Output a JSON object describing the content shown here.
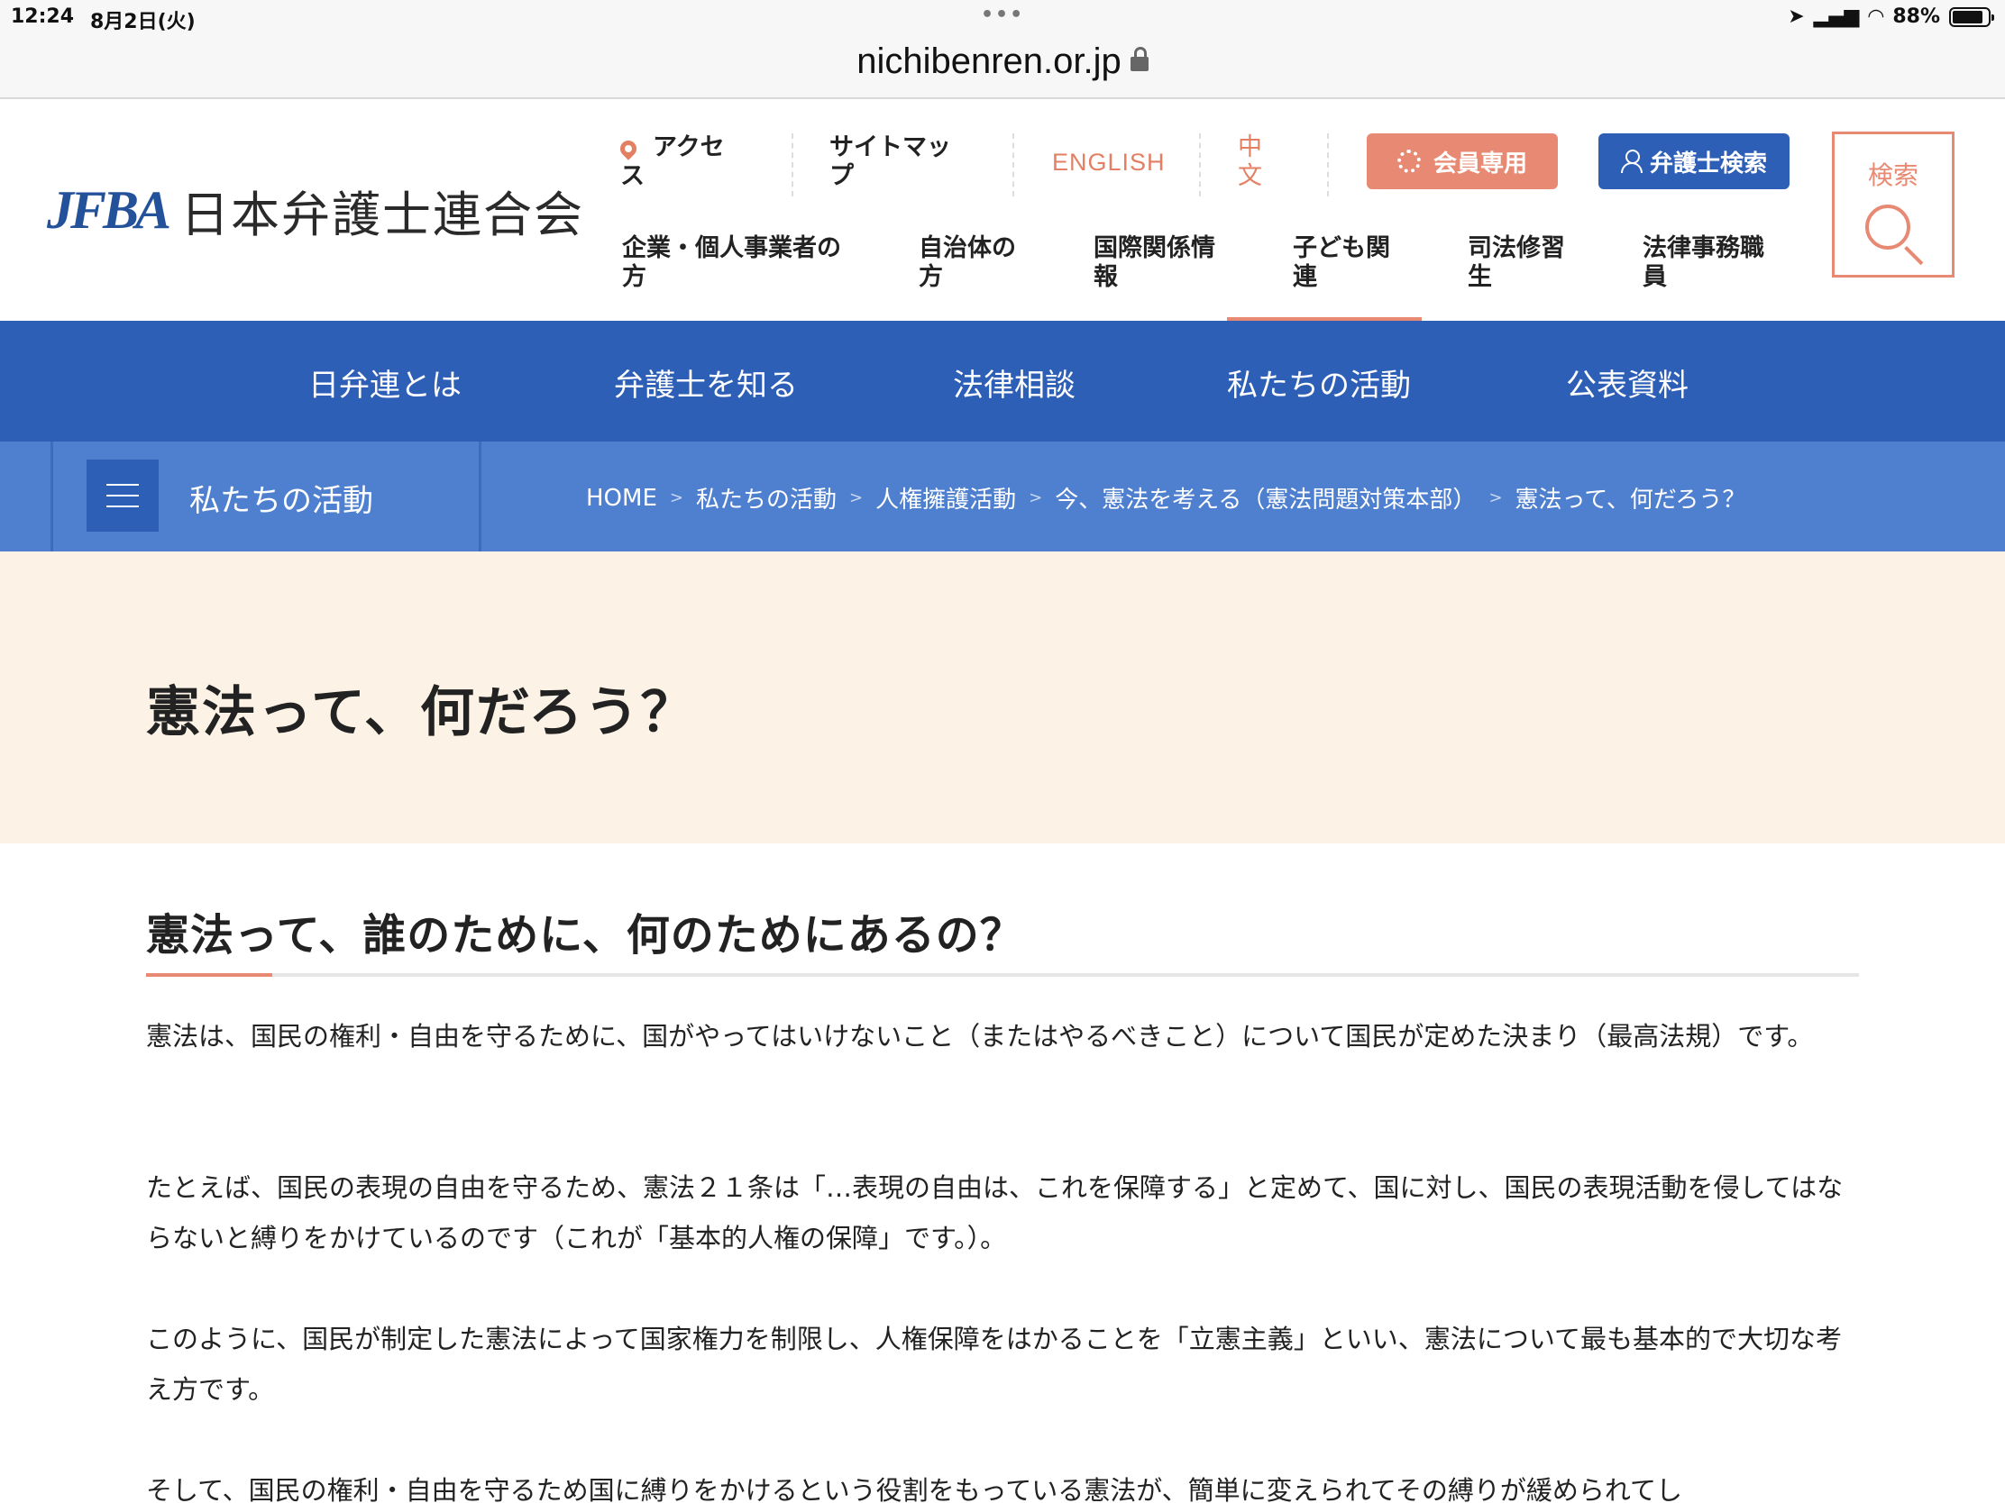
{
  "status": {
    "time": "12:24",
    "date": "8月2日(火)",
    "battery": "88%"
  },
  "browser": {
    "url": "nichibenren.or.jp"
  },
  "header": {
    "logo_mark": "JFBA",
    "logo_name": "日本弁護士連合会",
    "access": "アクセス",
    "sitemap": "サイトマップ",
    "english": "ENGLISH",
    "chinese": "中文",
    "member_button": "会員専用",
    "lawyer_search_button": "弁護士検索",
    "search": "検索",
    "categories": [
      "企業・個人事業者の方",
      "自治体の方",
      "国際関係情報",
      "子ども関連",
      "司法修習生",
      "法律事務職員"
    ]
  },
  "mainnav": [
    "日弁連とは",
    "弁護士を知る",
    "法律相談",
    "私たちの活動",
    "公表資料"
  ],
  "section": {
    "title": "私たちの活動"
  },
  "breadcrumb": [
    "HOME",
    "私たちの活動",
    "人権擁護活動",
    "今、憲法を考える（憲法問題対策本部）",
    "憲法って、何だろう？"
  ],
  "page": {
    "title": "憲法って、何だろう？",
    "heading": "憲法って、誰のために、何のためにあるの？",
    "paragraphs": [
      "憲法は、国民の権利・自由を守るために、国がやってはいけないこと（またはやるべきこと）について国民が定めた決まり（最高法規）です。",
      "たとえば、国民の表現の自由を守るため、憲法２１条は「…表現の自由は、これを保障する」と定めて、国に対し、国民の表現活動を侵してはならないと縛りをかけているのです（これが「基本的人権の保障」です。）。",
      "このように、国民が制定した憲法によって国家権力を制限し、人権保障をはかることを「立憲主義」といい、憲法について最も基本的で大切な考え方です。",
      "そして、国民の権利・自由を守るため国に縛りをかけるという役割をもっている憲法が、簡単に変えられてその縛りが緩められてし"
    ]
  }
}
